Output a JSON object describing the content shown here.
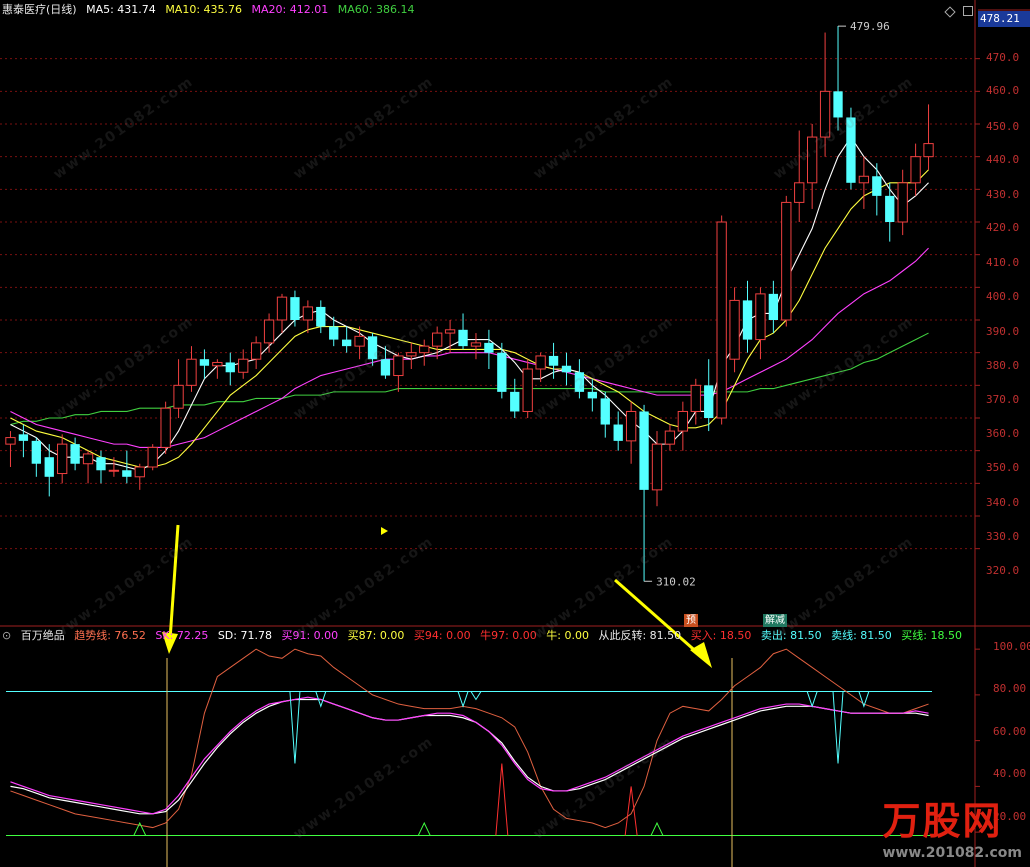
{
  "main_header": {
    "stock_name": "惠泰医疗(日线)",
    "ma5_label": "MA5: 431.74",
    "ma10_label": "MA10: 435.76",
    "ma20_label": "MA20: 412.01",
    "ma60_label": "MA60: 386.14"
  },
  "current_price_tag": "478.21",
  "price_axis": [
    "470.0",
    "460.0",
    "450.0",
    "440.0",
    "430.0",
    "420.0",
    "410.0",
    "400.0",
    "390.0",
    "380.0",
    "370.0",
    "360.0",
    "350.0",
    "340.0",
    "330.0",
    "320.0"
  ],
  "high_label": "479.96",
  "low_label": "310.02",
  "signal_tags": {
    "yu": "预",
    "jie_jian": "解减"
  },
  "sub_header": {
    "name": "百万绝品",
    "trend": "趋势线: 76.52",
    "sk": "SK: 72.25",
    "sd": "SD: 71.78",
    "buy91": "买91: 0.00",
    "buy87": "买87: 0.00",
    "buy94": "买94: 0.00",
    "niu97": "牛97: 0.00",
    "niu": "牛: 0.00",
    "reversal": "从此反转: 81.50",
    "buy_in": "买入: 18.50",
    "sell_out": "卖出: 81.50",
    "sell_line": "卖线: 81.50",
    "buy_line": "买线: 18.50"
  },
  "sub_axis": [
    "100.00",
    "80.00",
    "60.00",
    "40.00",
    "20.00"
  ],
  "watermark": {
    "text": "万股网",
    "url": "www.201082.com"
  },
  "logo": {
    "text": "万股网",
    "url": "www.201082.com"
  },
  "colors": {
    "up": "#f04040",
    "down": "#54ffff",
    "ma5": "#ffffff",
    "ma10": "#ffff40",
    "ma20": "#ff40ff",
    "ma60": "#40d040",
    "grid": "#7a1010"
  },
  "chart_data": {
    "type": "candlestick",
    "price_range": [
      310,
      480
    ],
    "candles": [
      [
        352,
        356,
        345,
        354
      ],
      [
        355,
        358,
        348,
        353
      ],
      [
        353,
        354,
        342,
        346
      ],
      [
        348,
        352,
        336,
        342
      ],
      [
        343,
        355,
        340,
        352
      ],
      [
        352,
        354,
        344,
        346
      ],
      [
        346,
        350,
        340,
        349
      ],
      [
        348,
        350,
        340,
        344
      ],
      [
        344,
        348,
        342,
        344
      ],
      [
        344,
        350,
        340,
        342
      ],
      [
        342,
        346,
        338,
        345
      ],
      [
        345,
        352,
        344,
        351
      ],
      [
        351,
        365,
        349,
        363
      ],
      [
        363,
        378,
        360,
        370
      ],
      [
        370,
        382,
        368,
        378
      ],
      [
        378,
        381,
        372,
        376
      ],
      [
        376,
        378,
        372,
        377
      ],
      [
        377,
        380,
        370,
        374
      ],
      [
        374,
        381,
        372,
        378
      ],
      [
        378,
        385,
        375,
        383
      ],
      [
        383,
        392,
        380,
        390
      ],
      [
        390,
        398,
        386,
        397
      ],
      [
        397,
        399,
        388,
        390
      ],
      [
        390,
        396,
        386,
        394
      ],
      [
        394,
        396,
        386,
        388
      ],
      [
        388,
        391,
        382,
        384
      ],
      [
        384,
        388,
        380,
        382
      ],
      [
        382,
        388,
        378,
        385
      ],
      [
        385,
        386,
        376,
        378
      ],
      [
        378,
        382,
        372,
        373
      ],
      [
        373,
        380,
        368,
        379
      ],
      [
        379,
        383,
        375,
        380
      ],
      [
        380,
        384,
        376,
        382
      ],
      [
        382,
        388,
        378,
        386
      ],
      [
        386,
        390,
        380,
        387
      ],
      [
        387,
        392,
        381,
        382
      ],
      [
        382,
        386,
        378,
        383
      ],
      [
        383,
        387,
        375,
        380
      ],
      [
        380,
        383,
        366,
        368
      ],
      [
        368,
        372,
        360,
        362
      ],
      [
        362,
        378,
        360,
        375
      ],
      [
        375,
        380,
        371,
        379
      ],
      [
        379,
        383,
        372,
        376
      ],
      [
        376,
        380,
        370,
        374
      ],
      [
        374,
        378,
        366,
        368
      ],
      [
        368,
        372,
        362,
        366
      ],
      [
        366,
        368,
        354,
        358
      ],
      [
        358,
        362,
        350,
        353
      ],
      [
        353,
        365,
        346,
        362
      ],
      [
        362,
        364,
        310,
        338
      ],
      [
        338,
        356,
        333,
        352
      ],
      [
        352,
        358,
        350,
        356
      ],
      [
        356,
        365,
        350,
        362
      ],
      [
        362,
        372,
        358,
        370
      ],
      [
        370,
        378,
        356,
        360
      ],
      [
        360,
        422,
        358,
        420
      ],
      [
        378,
        400,
        374,
        396
      ],
      [
        396,
        402,
        380,
        384
      ],
      [
        384,
        400,
        378,
        398
      ],
      [
        398,
        402,
        386,
        390
      ],
      [
        390,
        428,
        388,
        426
      ],
      [
        426,
        448,
        420,
        432
      ],
      [
        432,
        450,
        424,
        446
      ],
      [
        446,
        478,
        440,
        460
      ],
      [
        460,
        480,
        448,
        452
      ],
      [
        452,
        455,
        430,
        432
      ],
      [
        432,
        440,
        424,
        434
      ],
      [
        434,
        438,
        422,
        428
      ],
      [
        428,
        432,
        414,
        420
      ],
      [
        420,
        436,
        416,
        432
      ],
      [
        432,
        444,
        428,
        440
      ],
      [
        440,
        456,
        436,
        444
      ]
    ],
    "ma5": [
      358,
      356,
      354,
      350,
      348,
      348,
      348,
      346,
      346,
      345,
      344,
      346,
      350,
      356,
      364,
      372,
      376,
      376,
      377,
      378,
      382,
      386,
      390,
      392,
      393,
      390,
      388,
      386,
      383,
      381,
      379,
      378,
      379,
      380,
      382,
      384,
      384,
      384,
      381,
      377,
      372,
      372,
      374,
      375,
      374,
      370,
      367,
      363,
      359,
      356,
      352,
      352,
      356,
      362,
      362,
      376,
      382,
      390,
      392,
      392,
      402,
      410,
      418,
      430,
      440,
      446,
      440,
      436,
      430,
      425,
      428,
      432
    ],
    "ma10": [
      360,
      358,
      356,
      355,
      354,
      352,
      350,
      348,
      347,
      346,
      345,
      345,
      346,
      348,
      352,
      357,
      362,
      367,
      370,
      373,
      377,
      381,
      385,
      387,
      388,
      388,
      388,
      387,
      386,
      385,
      384,
      383,
      382,
      381,
      381,
      381,
      381,
      381,
      381,
      380,
      378,
      376,
      375,
      375,
      374,
      372,
      370,
      368,
      365,
      362,
      360,
      358,
      357,
      357,
      358,
      362,
      370,
      378,
      384,
      386,
      390,
      396,
      404,
      412,
      418,
      424,
      428,
      430,
      432,
      432,
      432,
      436
    ],
    "ma20": [
      362,
      360,
      358,
      357,
      356,
      355,
      354,
      353,
      352,
      352,
      351,
      351,
      351,
      352,
      353,
      354,
      356,
      358,
      360,
      362,
      364,
      366,
      369,
      371,
      373,
      374,
      375,
      376,
      377,
      378,
      378,
      378,
      379,
      379,
      380,
      380,
      380,
      380,
      379,
      378,
      377,
      376,
      375,
      374,
      373,
      372,
      371,
      370,
      369,
      368,
      367,
      367,
      367,
      367,
      367,
      368,
      370,
      372,
      374,
      376,
      378,
      381,
      384,
      388,
      392,
      395,
      398,
      400,
      402,
      405,
      408,
      412
    ],
    "ma60": [
      358,
      359,
      359,
      360,
      360,
      361,
      361,
      362,
      362,
      362,
      363,
      363,
      363,
      364,
      364,
      364,
      365,
      365,
      365,
      366,
      366,
      366,
      367,
      367,
      367,
      368,
      368,
      368,
      368,
      368,
      369,
      369,
      369,
      369,
      369,
      369,
      369,
      369,
      369,
      369,
      369,
      369,
      369,
      369,
      369,
      369,
      368,
      368,
      368,
      368,
      368,
      368,
      368,
      368,
      368,
      368,
      368,
      368,
      369,
      369,
      370,
      371,
      372,
      373,
      374,
      375,
      377,
      378,
      380,
      382,
      384,
      386
    ]
  },
  "sub_chart_data": {
    "type": "line",
    "y_range": [
      10,
      104
    ],
    "hlines": [
      81.5,
      18.5
    ],
    "trend": [
      38,
      36,
      34,
      32,
      30,
      28,
      27,
      26,
      25,
      24,
      23,
      22,
      24,
      30,
      45,
      72,
      88,
      92,
      96,
      100,
      97,
      96,
      100,
      98,
      97,
      92,
      88,
      84,
      80,
      78,
      76,
      75,
      74,
      74,
      74,
      75,
      74,
      72,
      70,
      66,
      55,
      40,
      30,
      26,
      25,
      24,
      22,
      24,
      28,
      40,
      60,
      72,
      75,
      74,
      73,
      78,
      84,
      88,
      92,
      98,
      100,
      96,
      92,
      88,
      84,
      80,
      76,
      74,
      72,
      72,
      74,
      76
    ],
    "sk": [
      42,
      40,
      38,
      36,
      35,
      34,
      33,
      32,
      31,
      30,
      29,
      28,
      30,
      36,
      44,
      52,
      58,
      64,
      69,
      73,
      76,
      77,
      78,
      79,
      78,
      76,
      74,
      72,
      70,
      69,
      69,
      70,
      71,
      72,
      72,
      71,
      68,
      64,
      58,
      50,
      43,
      39,
      38,
      38,
      40,
      42,
      44,
      47,
      50,
      53,
      56,
      59,
      62,
      64,
      66,
      68,
      70,
      72,
      74,
      75,
      76,
      76,
      75,
      74,
      73,
      72,
      72,
      72,
      72,
      72,
      73,
      72
    ],
    "sd": [
      40,
      39,
      37,
      35,
      34,
      33,
      32,
      31,
      30,
      29,
      28,
      28,
      29,
      34,
      42,
      50,
      57,
      63,
      68,
      72,
      75,
      77,
      78,
      78,
      78,
      76,
      74,
      72,
      70,
      69,
      69,
      70,
      71,
      71,
      71,
      70,
      68,
      64,
      59,
      51,
      44,
      40,
      38,
      38,
      39,
      41,
      43,
      46,
      49,
      52,
      55,
      58,
      61,
      63,
      65,
      67,
      69,
      71,
      73,
      74,
      75,
      75,
      75,
      74,
      73,
      72,
      72,
      72,
      72,
      72,
      72,
      71
    ]
  }
}
